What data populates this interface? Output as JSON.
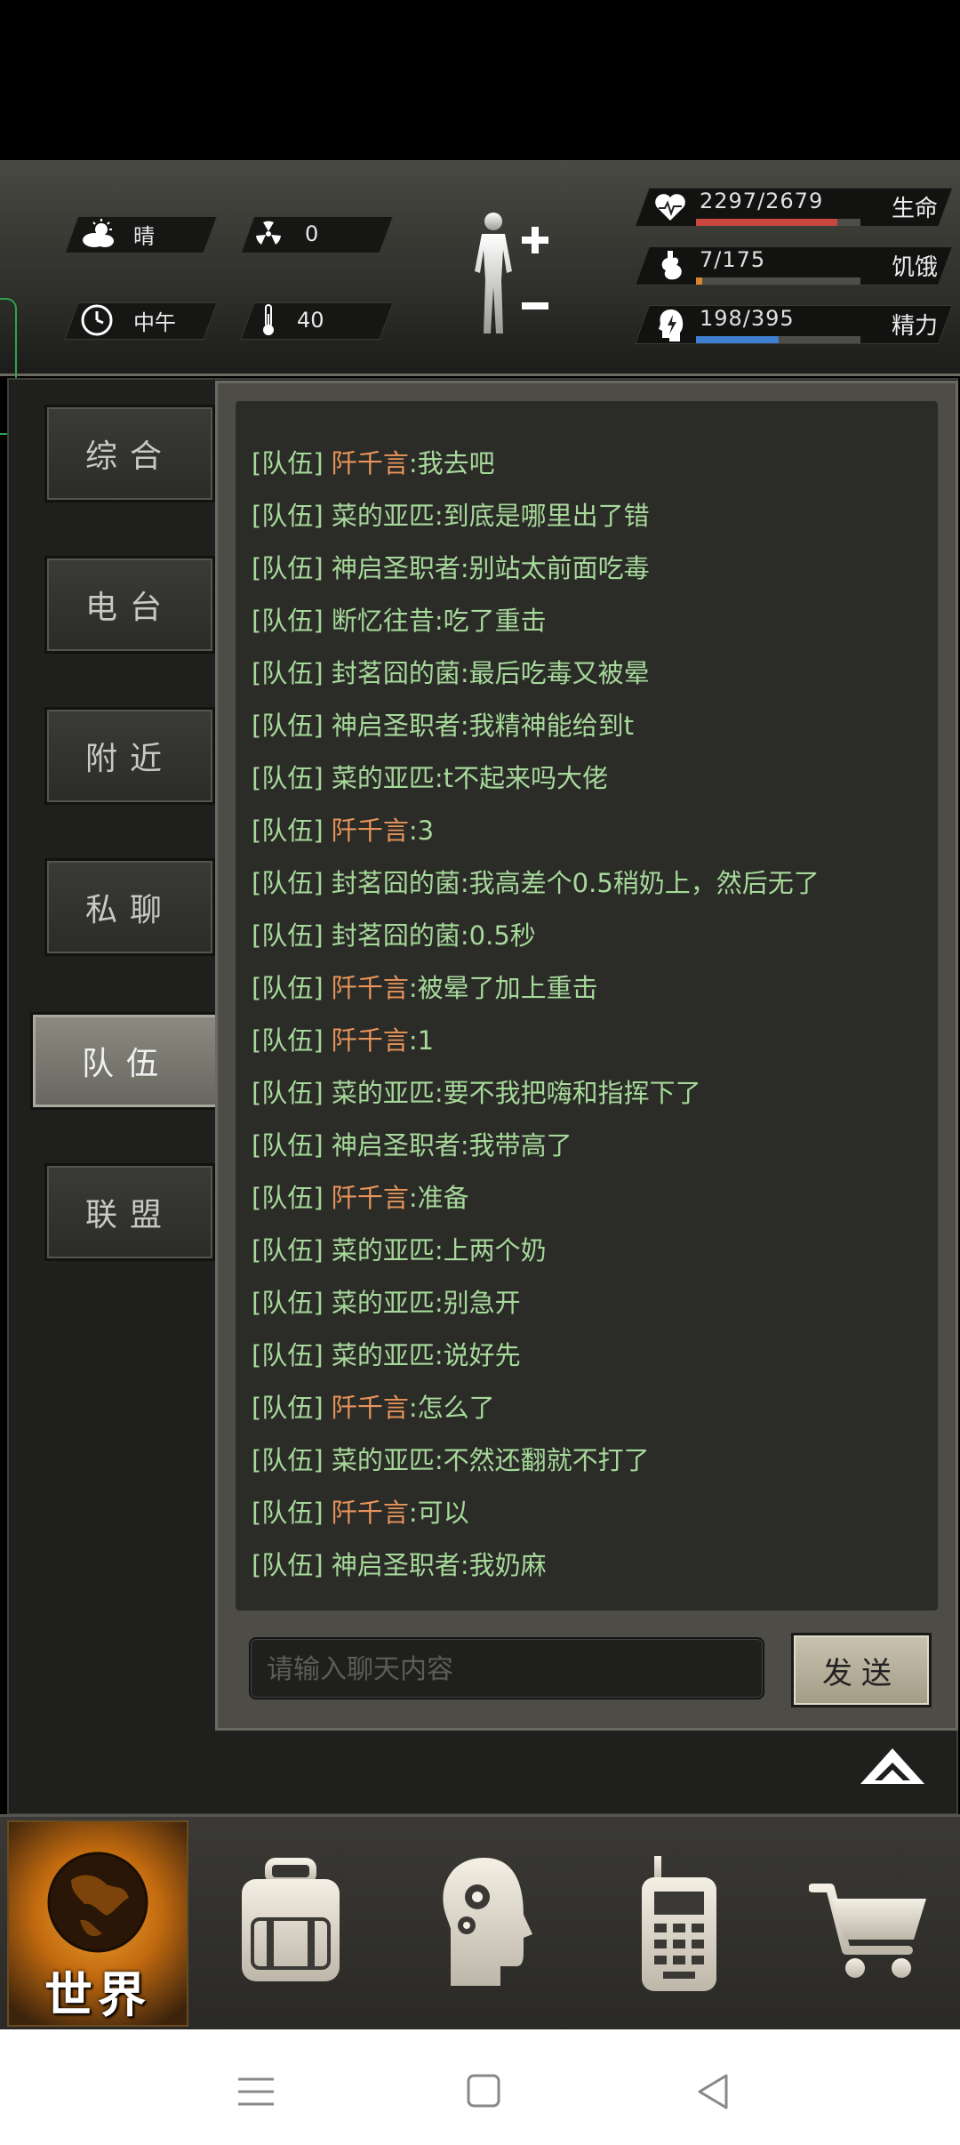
{
  "status": {
    "weather": {
      "label": "晴",
      "icon": "sun-cloud-icon"
    },
    "radiation": {
      "value": "0",
      "icon": "radiation-icon"
    },
    "time": {
      "label": "中午",
      "icon": "clock-icon"
    },
    "temperature": {
      "value": "40",
      "icon": "thermometer-icon"
    },
    "body_icon": "body-figure-icon",
    "vitals": [
      {
        "name": "health",
        "value": "2297/2679",
        "label": "生命",
        "fraction": 0.858,
        "color": "#c9473e",
        "icon": "heart-pulse-icon"
      },
      {
        "name": "hunger",
        "value": "7/175",
        "label": "饥饿",
        "fraction": 0.04,
        "color": "#d8892e",
        "icon": "stomach-icon"
      },
      {
        "name": "energy",
        "value": "198/395",
        "label": "精力",
        "fraction": 0.5,
        "color": "#3f7fd1",
        "icon": "head-bolt-icon"
      }
    ]
  },
  "tabs": [
    {
      "label": "综合",
      "active": false
    },
    {
      "label": "电台",
      "active": false
    },
    {
      "label": "附近",
      "active": false
    },
    {
      "label": "私聊",
      "active": false
    },
    {
      "label": "队伍",
      "active": true
    },
    {
      "label": "联盟",
      "active": false
    }
  ],
  "chat": {
    "channel_tag": "[队伍]",
    "messages": [
      {
        "name": "阡千言",
        "text": ":我去吧",
        "orange": true
      },
      {
        "name": "菜的亚匹",
        "text": ":到底是哪里出了错",
        "orange": false
      },
      {
        "name": "神启圣职者",
        "text": ":别站太前面吃毒",
        "orange": false
      },
      {
        "name": "断忆往昔",
        "text": ":吃了重击",
        "orange": false
      },
      {
        "name": "封茗囧的菌",
        "text": ":最后吃毒又被晕",
        "orange": false
      },
      {
        "name": "神启圣职者",
        "text": ":我精神能给到t",
        "orange": false
      },
      {
        "name": "菜的亚匹",
        "text": ":t不起来吗大佬",
        "orange": false
      },
      {
        "name": "阡千言",
        "text": ":3",
        "orange": true
      },
      {
        "name": "封茗囧的菌",
        "text": ":我高差个0.5稍奶上，然后无了",
        "orange": false
      },
      {
        "name": "封茗囧的菌",
        "text": ":0.5秒",
        "orange": false
      },
      {
        "name": "阡千言",
        "text": ":被晕了加上重击",
        "orange": true
      },
      {
        "name": "阡千言",
        "text": ":1",
        "orange": true
      },
      {
        "name": "菜的亚匹",
        "text": ":要不我把嗨和指挥下了",
        "orange": false
      },
      {
        "name": "神启圣职者",
        "text": ":我带高了",
        "orange": false
      },
      {
        "name": "阡千言",
        "text": ":准备",
        "orange": true
      },
      {
        "name": "菜的亚匹",
        "text": ":上两个奶",
        "orange": false
      },
      {
        "name": "菜的亚匹",
        "text": ":别急开",
        "orange": false
      },
      {
        "name": "菜的亚匹",
        "text": ":说好先",
        "orange": false
      },
      {
        "name": "阡千言",
        "text": ":怎么了",
        "orange": true
      },
      {
        "name": "菜的亚匹",
        "text": ":不然还翻就不打了",
        "orange": false
      },
      {
        "name": "阡千言",
        "text": ":可以",
        "orange": true
      },
      {
        "name": "神启圣职者",
        "text": ":我奶麻",
        "orange": false
      }
    ],
    "input_placeholder": "请输入聊天内容",
    "send_label": "发送"
  },
  "nav": {
    "world_label": "世界",
    "items": [
      "backpack-icon",
      "skills-head-icon",
      "radio-walkie-icon",
      "shop-cart-icon"
    ]
  },
  "system_nav": [
    "menu-icon",
    "home-square-icon",
    "back-triangle-icon"
  ]
}
